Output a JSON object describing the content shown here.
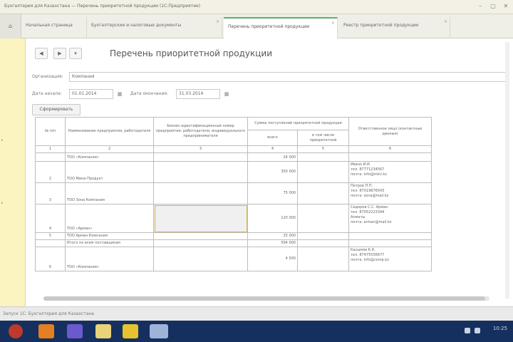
{
  "window": {
    "title": "Бухгалтерия для Казахстана — Перечень приоритетной продукции (1С:Предприятие)"
  },
  "tabs": [
    {
      "label": "Начальная страница"
    },
    {
      "label": "Бухгалтерские и налоговые документы"
    },
    {
      "label": "Перечень приоритетной продукции"
    },
    {
      "label": "Реестр приоритетной продукции"
    }
  ],
  "toolbar": {
    "back": "◀",
    "forward": "▶",
    "more": "▾"
  },
  "document": {
    "title": "Перечень приоритетной продукции"
  },
  "form": {
    "org_label": "Организация:",
    "org_value": "Компания",
    "date_from_label": "Дата начала:",
    "date_from": "01.01.2014",
    "date_to_label": "Дата окончания:",
    "date_to": "31.03.2014",
    "fill_button": "Сформировать"
  },
  "table": {
    "headers": {
      "num": "№ п/п",
      "name": "Наименование предприятия, работодателя",
      "bin": "Бизнес-идентификационный номер предприятия, работодателя, индивидуального предпринимателя",
      "group": "Сумма поступлений приоритетной продукции",
      "total": "всего",
      "incl": "в том числе приоритетной",
      "contact": "Ответственное лицо (контактные данные)"
    },
    "col_numbers": [
      "1",
      "2",
      "3",
      "4",
      "5",
      "6"
    ],
    "rows": [
      {
        "num": "",
        "name": "ТОО «Компания»",
        "bin": "",
        "total": "24 000",
        "incl": "",
        "contact": ""
      },
      {
        "num": "2",
        "name": "ТОО Мини Продукт",
        "bin": "",
        "total": "350 000",
        "incl": "",
        "contact": "Ивано И.И.\nтел. 87771234567\nпочта: info@mini.kz"
      },
      {
        "num": "3",
        "name": "ТОО Зона Компания",
        "bin": "",
        "total": "75 000",
        "incl": "",
        "contact": "Петров П.П.\nтел. 87019876543\nпочта: zona@mail.kz"
      },
      {
        "num": "4",
        "name": "ТОО «Арман»",
        "bin": "",
        "total": "120 000",
        "incl": "",
        "contact": "Сидоров С.С. Арман\nтел. 87052223344\nАлматы\nпочта: arman@mail.kz"
      },
      {
        "num": "5",
        "name": "ТОО Арман Компания",
        "bin": "",
        "total": "25 000",
        "incl": "",
        "contact": ""
      },
      {
        "num": "",
        "name": "Итого по всем поставщикам",
        "bin": "",
        "total": "594 000",
        "incl": "",
        "contact": ""
      },
      {
        "num": "6",
        "name": "ТОО «Компания»",
        "bin": "",
        "total": "4 500",
        "incl": "",
        "contact": "Касымов К.К.\nтел. 87475556677\nпочта: info@comp.kz"
      }
    ]
  },
  "statusbar": {
    "text": "Запуск 1С: Бухгалтерия для Казахстана"
  },
  "taskbar": {
    "clock": "10:25"
  },
  "colors": {
    "leftpanel": "#fbf3c0",
    "active_tab_accent": "#54b56a",
    "taskbar": "#15305e",
    "highlight_border": "#d9b45a"
  }
}
